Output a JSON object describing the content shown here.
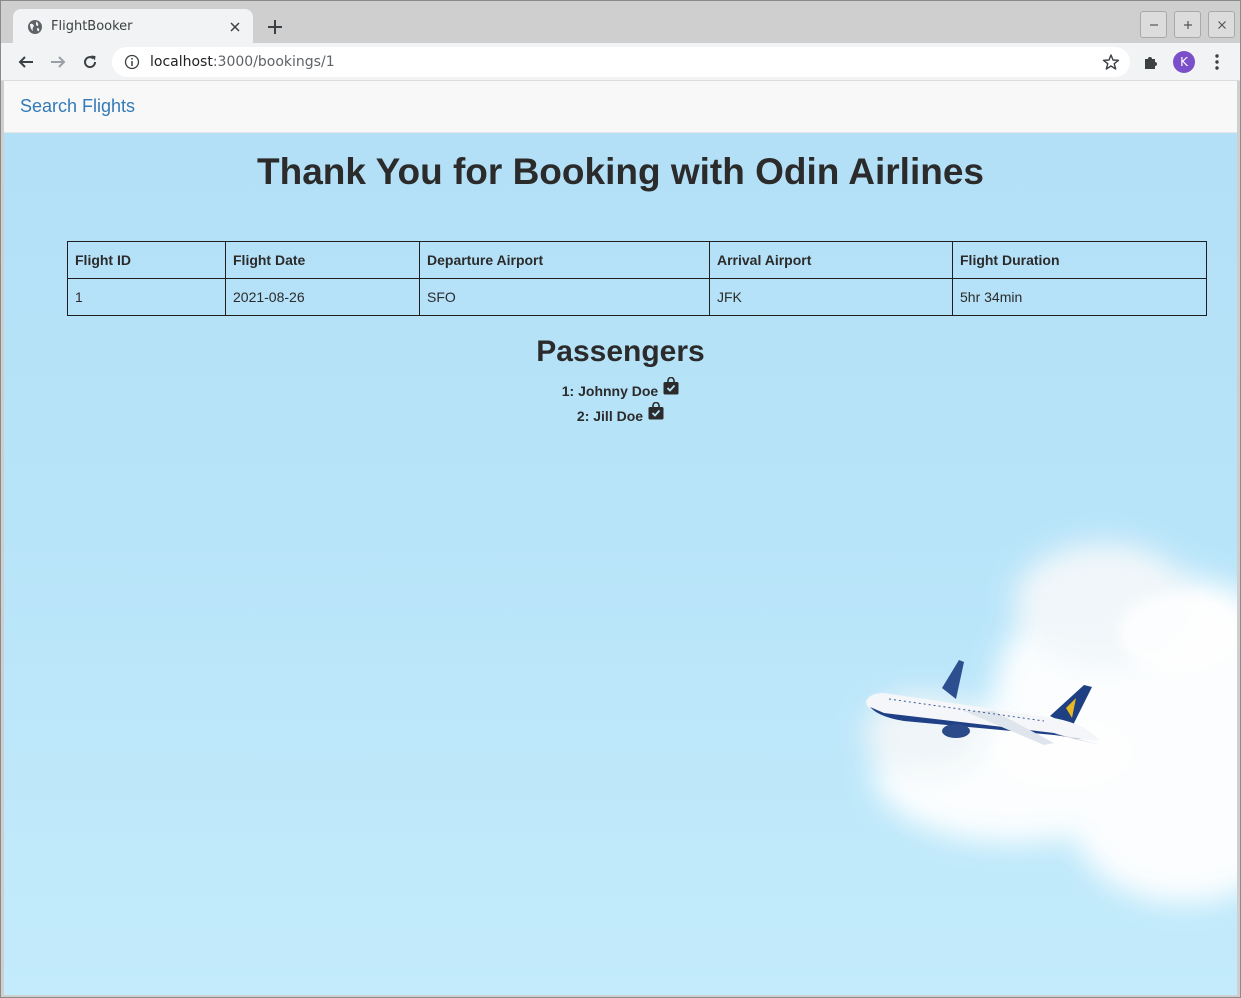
{
  "browser": {
    "tab_title": "FlightBooker",
    "url_host": "localhost",
    "url_path": ":3000/bookings/1",
    "profile_initial": "K"
  },
  "nav": {
    "search_flights_label": "Search Flights"
  },
  "page": {
    "heading": "Thank You for Booking with Odin Airlines",
    "table": {
      "headers": [
        "Flight ID",
        "Flight Date",
        "Departure Airport",
        "Arrival Airport",
        "Flight Duration"
      ],
      "row": [
        "1",
        "2021-08-26",
        "SFO",
        "JFK",
        "5hr 34min"
      ]
    },
    "passengers_heading": "Passengers",
    "passengers": [
      {
        "label": "1: Johnny Doe",
        "icon": "bag-check-icon"
      },
      {
        "label": "2: Jill Doe",
        "icon": "bag-check-icon"
      }
    ]
  },
  "colors": {
    "link": "#337ab7",
    "sky": "#b8e4f9",
    "text": "#2b2b2b",
    "avatar": "#7b4fc9"
  }
}
